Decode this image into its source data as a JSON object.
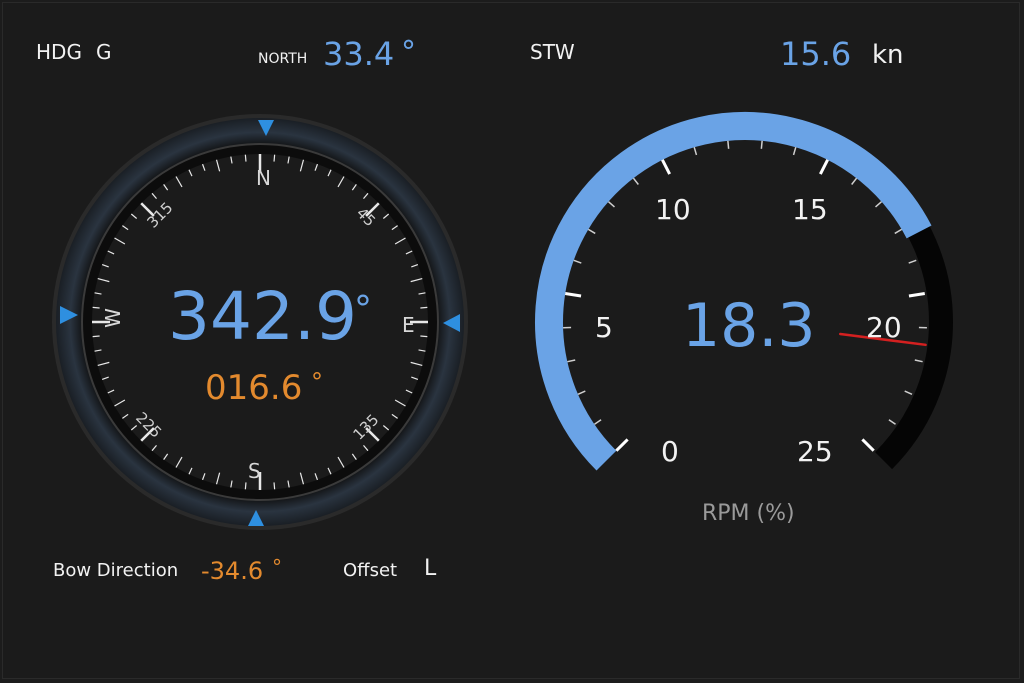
{
  "colors": {
    "background": "#1b1b1b",
    "accent_blue": "#6aa3e6",
    "accent_orange": "#e38a2e",
    "needle_red": "#d42020",
    "marker_blue": "#2e8fe0"
  },
  "header": {
    "hdg_label": "HDG",
    "hdg_source": "G",
    "north_label": "NORTH",
    "north_value": "33.4",
    "north_unit": "°",
    "stw_label": "STW",
    "stw_value": "15.6",
    "stw_unit": "kn"
  },
  "compass": {
    "heading_value": "342.9",
    "heading_unit": "°",
    "secondary_value": "016.6",
    "secondary_unit": "°",
    "cardinals": {
      "n": "N",
      "e": "E",
      "s": "S",
      "w": "W"
    },
    "intercardinals": {
      "ne": "45",
      "se": "135",
      "sw": "225",
      "nw": "315"
    },
    "icons": [
      "triangle-marker-icon"
    ]
  },
  "footer": {
    "bow_label": "Bow Direction",
    "bow_value": "-34.6",
    "bow_unit": "°",
    "offset_label": "Offset",
    "offset_value": "L"
  },
  "gauge": {
    "value": "18.3",
    "value_number": 18.3,
    "needle_value": 21.5,
    "unit_label": "RPM (%)",
    "range": [
      0,
      25
    ],
    "ticks": [
      "0",
      "5",
      "10",
      "15",
      "20",
      "25"
    ],
    "icons": [
      "needle-icon"
    ]
  }
}
